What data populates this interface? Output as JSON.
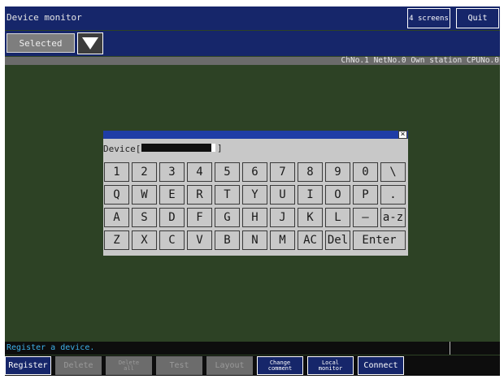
{
  "header": {
    "title": "Device monitor",
    "screens_button": "4 screens",
    "quit_button": "Quit"
  },
  "select": {
    "value": "Selected"
  },
  "station_info": "ChNo.1 NetNo.0 Own station CPUNo.0",
  "dialog": {
    "device_label": "Device[",
    "device_close_bracket": "]",
    "close_icon": "×",
    "keys": [
      [
        "1",
        "2",
        "3",
        "4",
        "5",
        "6",
        "7",
        "8",
        "9",
        "0",
        "\\"
      ],
      [
        "Q",
        "W",
        "E",
        "R",
        "T",
        "Y",
        "U",
        "I",
        "O",
        "P",
        "."
      ],
      [
        "A",
        "S",
        "D",
        "F",
        "G",
        "H",
        "J",
        "K",
        "L",
        "—",
        "a-z"
      ],
      [
        "Z",
        "X",
        "C",
        "V",
        "B",
        "N",
        "M",
        "AC",
        "Del",
        "Enter"
      ]
    ]
  },
  "status": {
    "message": "Register a device."
  },
  "buttons": [
    {
      "label": "Register",
      "state": "active"
    },
    {
      "label": "Delete",
      "state": "disabled"
    },
    {
      "label": "Delete\nall",
      "state": "disabled"
    },
    {
      "label": "Test",
      "state": "disabled"
    },
    {
      "label": "Layout",
      "state": "disabled"
    },
    {
      "label": "Change\ncomment",
      "state": "active"
    },
    {
      "label": "Local\nmonitor",
      "state": "active"
    },
    {
      "label": "Connect",
      "state": "active"
    }
  ]
}
